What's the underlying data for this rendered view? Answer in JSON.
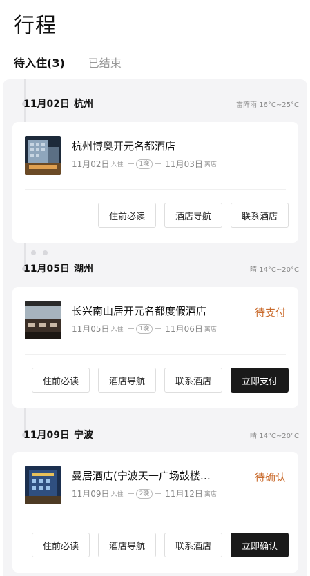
{
  "page": {
    "title": "行程"
  },
  "tabs": [
    {
      "label": "待入住(3)",
      "active": true
    },
    {
      "label": "已结束",
      "active": false
    }
  ],
  "trips": [
    {
      "date": "11月02日",
      "city": "杭州",
      "weather": "雷阵雨 16°C~25°C",
      "hotel": "杭州博奥开元名都酒店",
      "checkin_date": "11月02日",
      "checkin_label": "入住",
      "nights": "1晚",
      "checkout_date": "11月03日",
      "checkout_label": "离店",
      "status": "",
      "buttons": [
        "住前必读",
        "酒店导航",
        "联系酒店"
      ]
    },
    {
      "date": "11月05日",
      "city": "湖州",
      "weather": "晴 14°C~20°C",
      "hotel": "长兴南山居开元名都度假酒店",
      "checkin_date": "11月05日",
      "checkin_label": "入住",
      "nights": "1晚",
      "checkout_date": "11月06日",
      "checkout_label": "离店",
      "status": "待支付",
      "buttons": [
        "住前必读",
        "酒店导航",
        "联系酒店",
        "立即支付"
      ]
    },
    {
      "date": "11月09日",
      "city": "宁波",
      "weather": "晴 14°C~20°C",
      "hotel": "曼居酒店(宁波天一广场鼓楼…",
      "checkin_date": "11月09日",
      "checkin_label": "入住",
      "nights": "2晚",
      "checkout_date": "11月12日",
      "checkout_label": "离店",
      "status": "待确认",
      "buttons": [
        "住前必读",
        "酒店导航",
        "联系酒店",
        "立即确认"
      ]
    }
  ],
  "colors": {
    "status": "#c96a2b",
    "primary_button": "#1a1a1a",
    "background": "#f4f4f6"
  }
}
